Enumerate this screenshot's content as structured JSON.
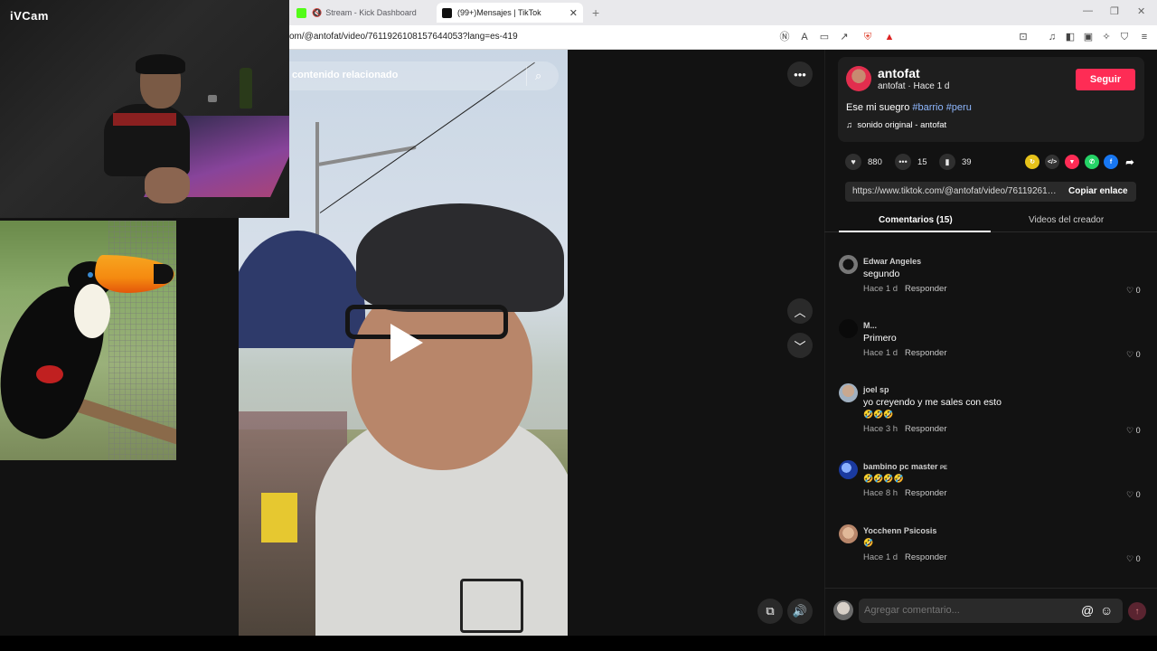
{
  "browser": {
    "tabs": [
      {
        "label": "Stream - Kick Dashboard",
        "active": false,
        "favicon_color": "#53fc18"
      },
      {
        "label": "(99+)Mensajes | TikTok",
        "active": true,
        "favicon_color": "#111111"
      }
    ],
    "url": "om/@antofat/video/7611926108157644053?lang=es-419"
  },
  "overlay": {
    "cam_logo": "iVCam"
  },
  "video": {
    "search_placeholder": "contenido relacionado"
  },
  "post": {
    "author": "antofat",
    "author_sub": "antofat · Hace 1 d",
    "follow_label": "Seguir",
    "caption_text": "Ese mi suegro",
    "hashtags": [
      "#barrio",
      "#peru"
    ],
    "sound": "sonido original - antofat",
    "likes": "880",
    "comments": "15",
    "saves": "39",
    "link": "https://www.tiktok.com/@antofat/video/761192610...",
    "copy_label": "Copiar enlace"
  },
  "panel_tabs": [
    {
      "label": "Comentarios (15)",
      "active": true
    },
    {
      "label": "Videos del creador",
      "active": false
    }
  ],
  "comments": [
    {
      "name": "Edwar Angeles",
      "text": "segundo",
      "time": "Hace 1 d",
      "reply": "Responder",
      "likes": "0"
    },
    {
      "name": "M...",
      "text": "Primero",
      "time": "Hace 1 d",
      "reply": "Responder",
      "likes": "0"
    },
    {
      "name": "joel sp",
      "text": "yo creyendo y me sales con esto",
      "emoji": "🤣🤣🤣",
      "time": "Hace 3 h",
      "reply": "Responder",
      "likes": "0"
    },
    {
      "name": "bambino pc master",
      "flag": "PE",
      "emoji": "🤣🤣🤣🤣",
      "time": "Hace 8 h",
      "reply": "Responder",
      "likes": "0"
    },
    {
      "name": "Yocchenn Psicosis",
      "emoji": "🤣",
      "time": "Hace 1 d",
      "reply": "Responder",
      "likes": "0"
    }
  ],
  "composer": {
    "placeholder": "Agregar comentario..."
  },
  "colors": {
    "accent": "#fe2c55",
    "hashtag": "#8fb8ff",
    "panel_bg": "#121212",
    "card_bg": "#1e1e1e"
  },
  "icons": [
    "more-icon",
    "search-icon",
    "play-icon",
    "chevron-up-icon",
    "chevron-down-icon",
    "pip-icon",
    "volume-icon",
    "heart-icon",
    "comment-icon",
    "bookmark-icon",
    "music-note-icon",
    "share-arrow-icon",
    "emoji-icon",
    "at-icon",
    "send-icon"
  ]
}
